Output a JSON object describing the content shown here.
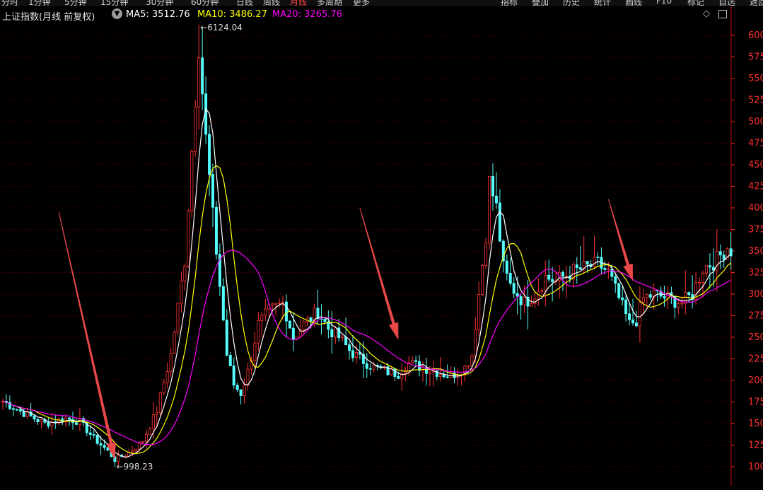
{
  "toolbar": {
    "periods": [
      "分时",
      "1分钟",
      "5分钟",
      "15分钟",
      "30分钟",
      "60分钟",
      "日线",
      "周线",
      "月线",
      "多周期",
      "更多"
    ],
    "active_period": "月线",
    "right_buttons": [
      "指标",
      "叠加",
      "历史",
      "统计",
      "画线",
      "F10",
      "标记",
      "自选",
      "返回"
    ]
  },
  "header": {
    "title": "上证指数(月线 前复权)",
    "ma5_label": "MA5: 3512.76",
    "ma10_label": "MA10: 3486.27",
    "ma20_label": "MA20: 3265.76"
  },
  "colors": {
    "ma5": "#ffffff",
    "ma10": "#ffff00",
    "ma20": "#ff00ff",
    "up": "#ff3232",
    "down": "#54fcfc",
    "grid": "#7a0000",
    "axis_text": "#ff3030",
    "arrow": "#e84848"
  },
  "chart_data": {
    "type": "candlestick",
    "title": "上证指数(月线 前复权)",
    "ylim": [
      950,
      6300
    ],
    "y_ticks": [
      1000,
      1250,
      1500,
      1750,
      2000,
      2250,
      2500,
      2750,
      3000,
      3250,
      3500,
      3750,
      4000,
      4250,
      4500,
      4750,
      5000,
      5250,
      5500,
      5750,
      6000
    ],
    "y_tick_labels": [
      "100",
      "125",
      "150",
      "175",
      "200",
      "225",
      "250",
      "275",
      "300",
      "325",
      "350",
      "375",
      "400",
      "425",
      "450",
      "475",
      "500",
      "525",
      "550",
      "575",
      "600"
    ],
    "annotations": [
      {
        "text": "6124.04",
        "x_index": 56,
        "value": 6124.04,
        "kind": "high"
      },
      {
        "text": "998.23",
        "x_index": 32,
        "value": 998.23,
        "kind": "low"
      }
    ],
    "arrows": [
      {
        "from": [
          16,
          3950
        ],
        "to": [
          32,
          1080
        ]
      },
      {
        "from": [
          102,
          4000
        ],
        "to": [
          113,
          2470
        ]
      },
      {
        "from": [
          173,
          4100
        ],
        "to": [
          180,
          3150
        ]
      }
    ],
    "anchors": [
      [
        0,
        1760
      ],
      [
        6,
        1620
      ],
      [
        12,
        1500
      ],
      [
        18,
        1560
      ],
      [
        22,
        1520
      ],
      [
        26,
        1330
      ],
      [
        30,
        1180
      ],
      [
        32,
        1080
      ],
      [
        36,
        1160
      ],
      [
        40,
        1300
      ],
      [
        44,
        1650
      ],
      [
        48,
        2300
      ],
      [
        52,
        3400
      ],
      [
        55,
        5300
      ],
      [
        56,
        5900
      ],
      [
        58,
        4800
      ],
      [
        60,
        3900
      ],
      [
        62,
        3100
      ],
      [
        64,
        2300
      ],
      [
        66,
        1950
      ],
      [
        68,
        1850
      ],
      [
        70,
        2100
      ],
      [
        73,
        2650
      ],
      [
        76,
        2800
      ],
      [
        80,
        2900
      ],
      [
        83,
        2500
      ],
      [
        86,
        2650
      ],
      [
        90,
        2800
      ],
      [
        93,
        2600
      ],
      [
        96,
        2500
      ],
      [
        99,
        2350
      ],
      [
        102,
        2250
      ],
      [
        106,
        2150
      ],
      [
        110,
        2100
      ],
      [
        113,
        2080
      ],
      [
        116,
        2200
      ],
      [
        120,
        2150
      ],
      [
        124,
        2100
      ],
      [
        128,
        2050
      ],
      [
        132,
        2150
      ],
      [
        134,
        2300
      ],
      [
        136,
        3000
      ],
      [
        138,
        3700
      ],
      [
        139,
        4300
      ],
      [
        141,
        4000
      ],
      [
        143,
        3300
      ],
      [
        145,
        3100
      ],
      [
        149,
        2900
      ],
      [
        152,
        3000
      ],
      [
        155,
        3200
      ],
      [
        158,
        3150
      ],
      [
        162,
        3250
      ],
      [
        166,
        3300
      ],
      [
        170,
        3350
      ],
      [
        173,
        3250
      ],
      [
        176,
        2950
      ],
      [
        179,
        2650
      ],
      [
        181,
        2700
      ],
      [
        183,
        2950
      ],
      [
        186,
        3000
      ],
      [
        190,
        2950
      ],
      [
        194,
        2900
      ],
      [
        197,
        3000
      ],
      [
        200,
        3300
      ],
      [
        204,
        3400
      ],
      [
        207,
        3550
      ],
      [
        208,
        3510
      ]
    ],
    "ma5_last": 3512.76,
    "ma10_last": 3486.27,
    "ma20_last": 3265.76
  }
}
